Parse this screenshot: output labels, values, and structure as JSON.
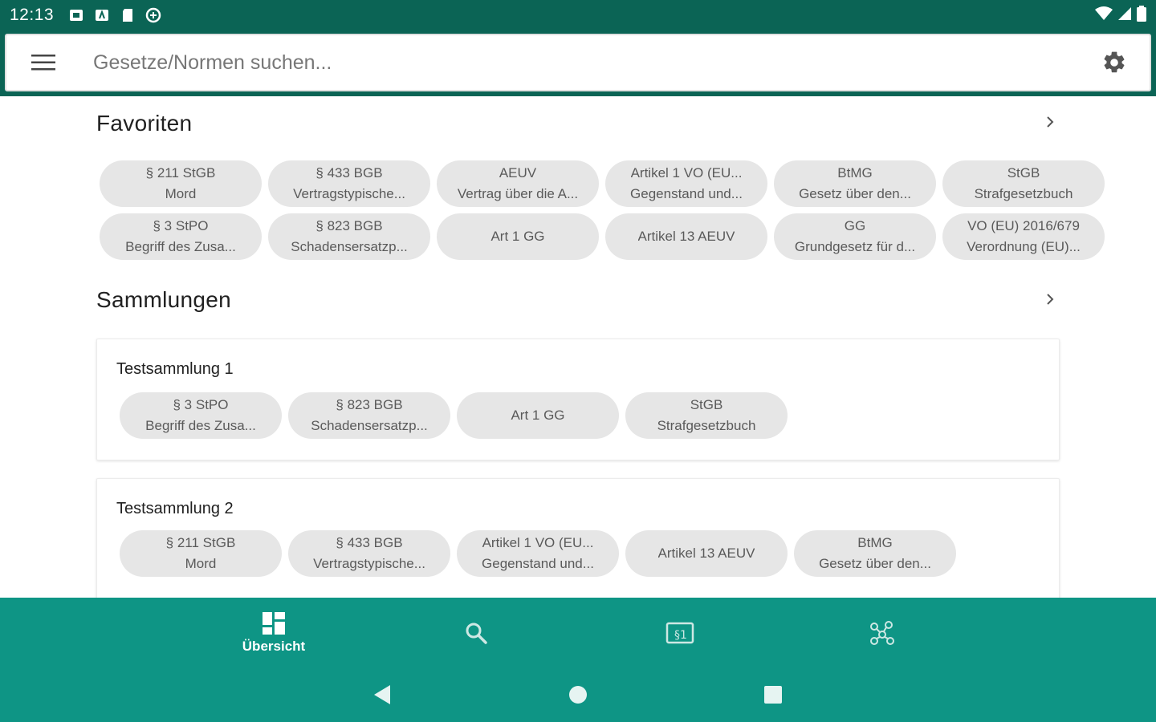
{
  "statusbar": {
    "time": "12:13"
  },
  "search": {
    "placeholder": "Gesetze/Normen suchen..."
  },
  "favorites": {
    "title": "Favoriten",
    "chips": [
      {
        "line1": "§ 211 StGB",
        "line2": "Mord"
      },
      {
        "line1": "§ 433 BGB",
        "line2": "Vertragstypische..."
      },
      {
        "line1": "AEUV",
        "line2": "Vertrag über die A..."
      },
      {
        "line1": "Artikel 1 VO (EU...",
        "line2": "Gegenstand und..."
      },
      {
        "line1": "BtMG",
        "line2": "Gesetz über den..."
      },
      {
        "line1": "StGB",
        "line2": "Strafgesetzbuch"
      },
      {
        "line1": "§ 3 StPO",
        "line2": "Begriff des Zusa..."
      },
      {
        "line1": "§ 823 BGB",
        "line2": "Schadensersatzp..."
      },
      {
        "line1": "Art 1 GG",
        "line2": ""
      },
      {
        "line1": "Artikel 13 AEUV",
        "line2": ""
      },
      {
        "line1": "GG",
        "line2": "Grundgesetz für d..."
      },
      {
        "line1": "VO (EU) 2016/679",
        "line2": "Verordnung (EU)..."
      }
    ]
  },
  "collections": {
    "title": "Sammlungen",
    "items": [
      {
        "name": "Testsammlung 1",
        "chips": [
          {
            "line1": "§ 3 StPO",
            "line2": "Begriff des Zusa..."
          },
          {
            "line1": "§ 823 BGB",
            "line2": "Schadensersatzp..."
          },
          {
            "line1": "Art 1 GG",
            "line2": ""
          },
          {
            "line1": "StGB",
            "line2": "Strafgesetzbuch"
          }
        ]
      },
      {
        "name": "Testsammlung 2",
        "chips": [
          {
            "line1": "§ 211 StGB",
            "line2": "Mord"
          },
          {
            "line1": "§ 433 BGB",
            "line2": "Vertragstypische..."
          },
          {
            "line1": "Artikel 1 VO (EU...",
            "line2": "Gegenstand und..."
          },
          {
            "line1": "Artikel 13 AEUV",
            "line2": ""
          },
          {
            "line1": "BtMG",
            "line2": "Gesetz über den..."
          }
        ]
      }
    ]
  },
  "bottomnav": {
    "items": [
      {
        "label": "Übersicht",
        "icon": "dashboard-icon",
        "active": true
      },
      {
        "label": "",
        "icon": "search-icon",
        "active": false
      },
      {
        "label": "",
        "icon": "paragraph-icon",
        "active": false
      },
      {
        "label": "",
        "icon": "network-icon",
        "active": false
      }
    ]
  },
  "colors": {
    "primary_dark": "#0b6455",
    "primary": "#0e9585",
    "chip_bg": "#e6e6e6"
  }
}
